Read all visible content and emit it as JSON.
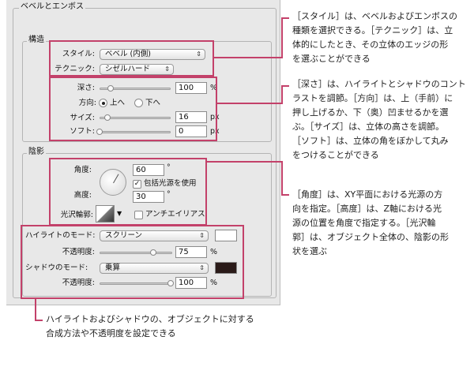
{
  "bevel_emboss": {
    "title": "ベベルとエンボス",
    "structure": {
      "title": "構造",
      "style_label": "スタイル:",
      "style_value": "ベベル (内側)",
      "technique_label": "テクニック:",
      "technique_value": "シゼルハード",
      "depth_label": "深さ:",
      "depth_value": "100",
      "depth_unit": "%",
      "depth_level": 1.0,
      "direction_label": "方向:",
      "direction_up": "上へ",
      "direction_down": "下へ",
      "size_label": "サイズ:",
      "size_value": "16",
      "size_unit": "px",
      "soften_label": "ソフト:",
      "soften_value": "0",
      "soften_unit": "px"
    },
    "shading": {
      "title": "陰影",
      "angle_label": "角度:",
      "angle_value": "60",
      "degree": "°",
      "global_light_label": "包括光源を使用",
      "altitude_label": "高度:",
      "altitude_value": "30",
      "gloss_label": "光沢輪郭:",
      "antialias_label": "アンチエイリアス",
      "highlight_mode_label": "ハイライトのモード:",
      "highlight_mode_value": "スクリーン",
      "highlight_color": "#ffffff",
      "highlight_opacity_label": "不透明度:",
      "highlight_opacity_value": "75",
      "shadow_mode_label": "シャドウのモード:",
      "shadow_mode_value": "乗算",
      "shadow_color": "#2a1a18",
      "shadow_opacity_label": "不透明度:",
      "shadow_opacity_value": "100",
      "percent": "%"
    }
  },
  "annotations": {
    "note1": [
      "［スタイル］は、ベベルおよびエンボスの",
      "種類を選択できる。［テクニック］は、立",
      "体的にしたとき、その立体のエッジの形",
      "を選ぶことができる"
    ],
    "note2": [
      "［深さ］は、ハイライトとシャドウのコント",
      "ラストを調節。［方向］は、上（手前）に",
      "押し上げるか、下（奥）凹ませるかを選",
      "ぶ。［サイズ］は、立体の高さを調節。",
      "［ソフト］は、立体の角をぼかして丸み",
      "をつけることができる"
    ],
    "note3": [
      "［角度］は、XY平面における光源の方",
      "向を指定。［高度］は、Z軸における光",
      "源の位置を角度で指定する。［光沢輪",
      "郭］は、オブジェクト全体の、陰影の形",
      "状を選ぶ"
    ],
    "note4": [
      "ハイライトおよびシャドウの、オブジェクトに対する",
      "合成方法や不透明度を設定できる"
    ]
  },
  "colors": {
    "accent": "#c3416a",
    "panel": "#e8e8e8"
  }
}
